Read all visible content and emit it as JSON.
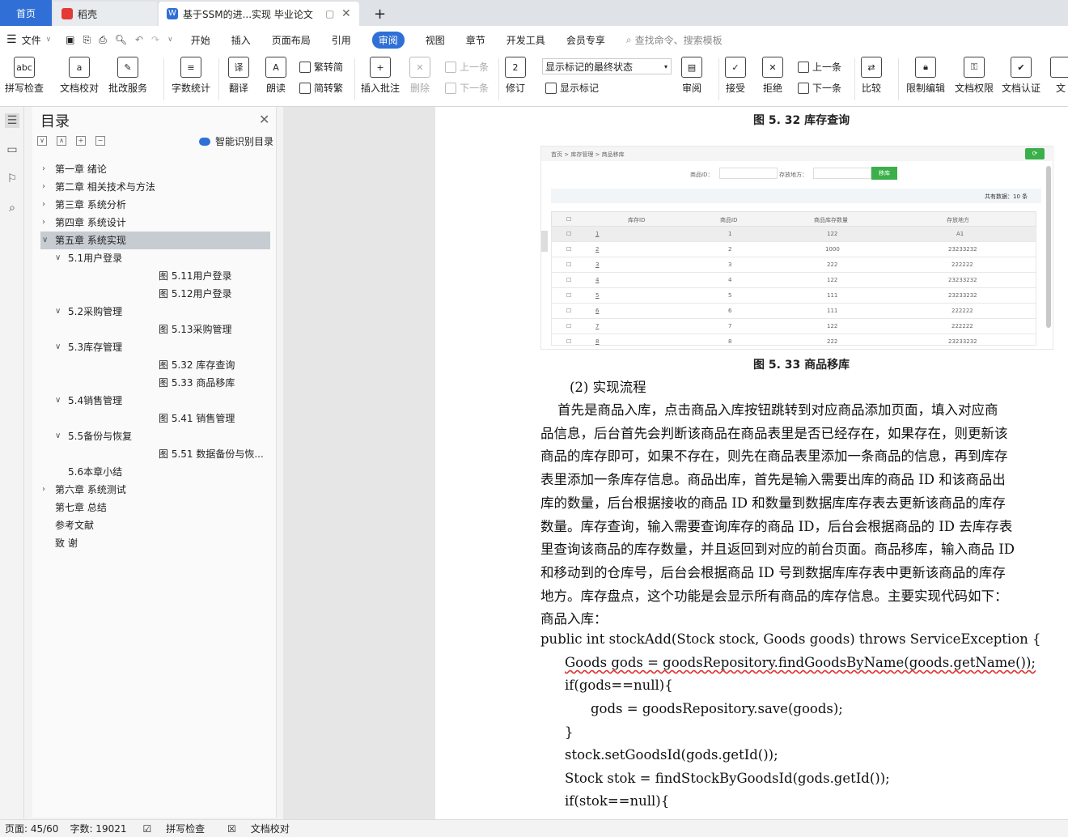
{
  "tabs": {
    "home": "首页",
    "daoke": "稻壳",
    "doc": "基于SSM的进...实现 毕业论文",
    "add": "+"
  },
  "menu": {
    "file": "文件",
    "items": [
      "开始",
      "插入",
      "页面布局",
      "引用",
      "审阅",
      "视图",
      "章节",
      "开发工具",
      "会员专享"
    ],
    "search": "查找命令、搜索模板"
  },
  "ribbon": {
    "spell": "拼写检查",
    "proof": "文档校对",
    "batch": "批改服务",
    "count": "字数统计",
    "translate": "翻译",
    "read": "朗读",
    "t2s": "繁转简",
    "s2t": "简转繁",
    "comment": "插入批注",
    "delete": "删除",
    "prev": "上一条",
    "next": "下一条",
    "revise": "修订",
    "markup_state": "显示标记的最终状态",
    "show_markup": "显示标记",
    "review": "审阅",
    "accept": "接受",
    "reject": "拒绝",
    "prev2": "上一条",
    "next2": "下一条",
    "compare": "比较",
    "restrict": "限制编辑",
    "rights": "文档权限",
    "certify": "文档认证",
    "more": "文"
  },
  "toc": {
    "title": "目录",
    "smart": "智能识别目录",
    "items": [
      "第一章  绪论",
      "第二章  相关技术与方法",
      "第三章  系统分析",
      "第四章  系统设计",
      "第五章  系统实现",
      "5.1用户登录",
      "图 5.11用户登录",
      "图 5.12用户登录",
      "5.2采购管理",
      "图 5.13采购管理",
      "5.3库存管理",
      "图 5.32 库存查询",
      "图 5.33 商品移库",
      "5.4销售管理",
      "图 5.41  销售管理",
      "5.5备份与恢复",
      "图 5.51  数据备份与恢...",
      "5.6本章小结",
      "第六章  系统测试",
      "第七章  总结",
      "参考文献",
      "致    谢"
    ]
  },
  "doc": {
    "caption1": "图 5. 32 库存查询",
    "caption2": "图 5. 33 商品移库",
    "screenshot": {
      "breadcrumb": "首页  >  库存管理  >  商品移库",
      "id_label": "商品ID：",
      "loc_label": "存放地方：",
      "move_btn": "移库",
      "total": "共有数据：10 条",
      "headers": [
        "库存ID",
        "商品ID",
        "商品库存数量",
        "存放地方"
      ],
      "rows": [
        [
          "1",
          "1",
          "122",
          "A1"
        ],
        [
          "2",
          "2",
          "1000",
          "23233232"
        ],
        [
          "3",
          "3",
          "222",
          "222222"
        ],
        [
          "4",
          "4",
          "122",
          "23233232"
        ],
        [
          "5",
          "5",
          "111",
          "23233232"
        ],
        [
          "6",
          "6",
          "111",
          "222222"
        ],
        [
          "7",
          "7",
          "122",
          "222222"
        ],
        [
          "8",
          "8",
          "222",
          "23233232"
        ]
      ]
    },
    "heading": "(2)  实现流程",
    "lines": [
      "    首先是商品入库，点击商品入库按钮跳转到对应商品添加页面，填入对应商",
      "品信息，后台首先会判断该商品在商品表里是否已经存在，如果存在，则更新该",
      "商品的库存即可，如果不存在，则先在商品表里添加一条商品的信息，再到库存",
      "表里添加一条库存信息。商品出库，首先是输入需要出库的商品 ID 和该商品出",
      "库的数量，后台根据接收的商品 ID 和数量到数据库库存表去更新该商品的库存",
      "数量。库存查询，输入需要查询库存的商品 ID，后台会根据商品的 ID 去库存表",
      "里查询该商品的库存数量，并且返回到对应的前台页面。商品移库，输入商品 ID",
      "和移动到的仓库号，后台会根据商品 ID 号到数据库库存表中更新该商品的库存",
      "地方。库存盘点，这个功能是会显示所有商品的库存信息。主要实现代码如下：",
      "商品入库："
    ],
    "code": [
      "public int stockAdd(Stock stock, Goods goods) throws ServiceException {",
      "Goods gods = goodsRepository.findGoodsByName(goods.getName());",
      "if(gods==null){",
      "gods = goodsRepository.save(goods);",
      "}",
      "stock.setGoodsId(gods.getId());",
      "Stock stok = findStockByGoodsId(gods.getId());",
      "if(stok==null){"
    ]
  },
  "status": {
    "page": "页面: 45/60",
    "words": "字数: 19021",
    "spell": "拼写检查",
    "proof": "文档校对"
  }
}
